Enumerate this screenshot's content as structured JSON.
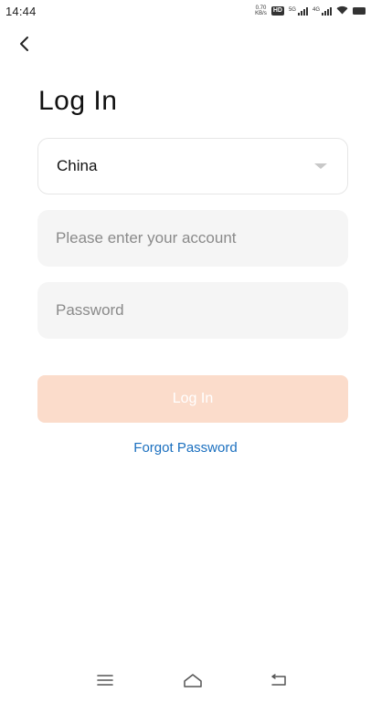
{
  "status_bar": {
    "time": "14:44",
    "speed_value": "0.70",
    "speed_unit": "KB/s",
    "hd_label": "HD",
    "sim1_label": "5G",
    "sim2_label": "4G"
  },
  "header": {
    "back_icon": "chevron-left-icon",
    "title": "Log In"
  },
  "form": {
    "country": {
      "value": "China",
      "icon": "caret-down-icon"
    },
    "account": {
      "value": "",
      "placeholder": "Please enter your account"
    },
    "password": {
      "value": "",
      "placeholder": "Password"
    },
    "login_label": "Log In",
    "forgot_label": "Forgot Password"
  },
  "nav_bar": {
    "menu_icon": "menu-icon",
    "home_icon": "home-icon",
    "back_icon": "back-icon"
  },
  "colors": {
    "login_button_bg": "#fbdccb",
    "link": "#1a6fbf",
    "input_bg": "#f5f5f5"
  }
}
